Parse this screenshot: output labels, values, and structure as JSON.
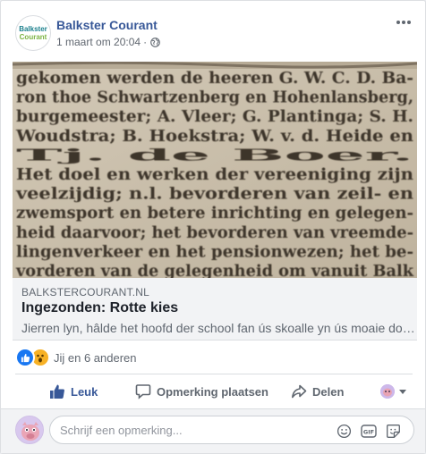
{
  "post": {
    "page_name": "Balkster Courant",
    "logo_line1": "Balkster",
    "logo_line2": "Courant",
    "timestamp": "1 maart om 20:04",
    "separator": "·",
    "audience_icon": "globe-icon",
    "more_icon": "more-dots-icon"
  },
  "image": {
    "lines": [
      "gekomen werden de heeren G. W. C. D. Ba-",
      "ron thoe Schwartzenberg en Hohenlansberg,",
      "burgemeester; A. Vleer; G. Plantinga; S. H.",
      "Woudstra; B. Hoekstra; W. v. d. Heide en",
      "Tj. de Boer.",
      "  Het doel en werken der vereeniging zijn",
      "veelzijdig; n.l. bevorderen van zeil- en",
      "zwemsport en betere inrichting en gelegen-",
      "heid daarvoor; het bevorderen van vreemde-",
      "lingenverkeer en het pensionwezen; het be-",
      "vorderen van de gelegenheid om vanuit Balk"
    ]
  },
  "link": {
    "domain": "BALKSTERCOURANT.NL",
    "title": "Ingezonden: Rotte kies",
    "description": "Jierren lyn, hâlde het hoofd der school fan ús skoalle yn ús moaie doarpke hj..."
  },
  "reactions": {
    "icons": [
      "like-reaction-icon",
      "wow-reaction-icon"
    ],
    "summary": "Jij en 6 anderen"
  },
  "actions": {
    "like": "Leuk",
    "comment": "Opmerking plaatsen",
    "share": "Delen"
  },
  "composer": {
    "placeholder": "Schrijf een opmerking...",
    "icons": [
      "emoji-icon",
      "gif-icon",
      "sticker-icon"
    ],
    "gif_label": "GIF"
  },
  "colors": {
    "link_blue": "#385898",
    "like_blue": "#1877f2",
    "wow_yellow": "#f7b125",
    "muted_text": "#606770"
  }
}
